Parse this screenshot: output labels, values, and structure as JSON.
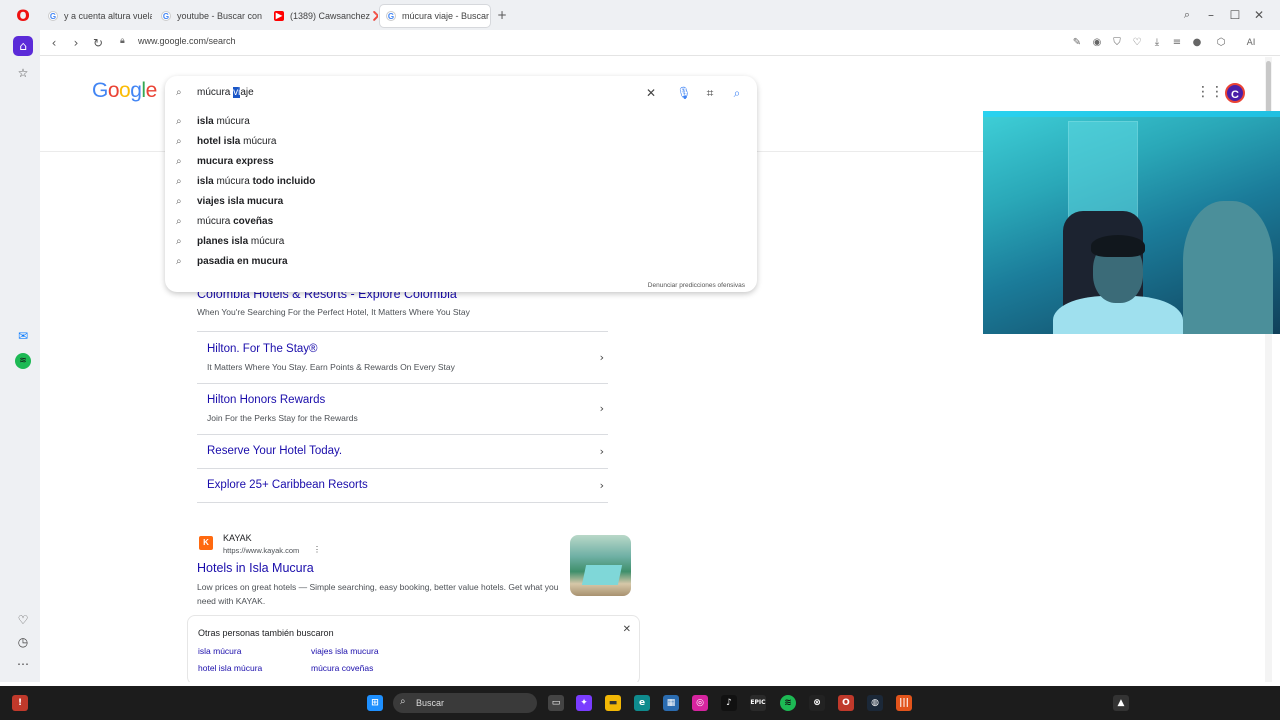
{
  "browser": {
    "tabs": [
      {
        "title": "y a cuenta altura vuela el a"
      },
      {
        "title": "youtube - Buscar con Goo"
      },
      {
        "title": "(1389) Cawsanchez ❌ Ma"
      },
      {
        "title": "múcura viaje - Buscar con"
      }
    ],
    "new_tab": "+",
    "url": "www.google.com/search",
    "ai_label": "AI"
  },
  "google": {
    "logo": [
      "G",
      "o",
      "o",
      "g",
      "l",
      "e"
    ],
    "search": {
      "query_before": "múcura ",
      "query_selected": "vi",
      "query_after": "aje"
    },
    "suggestions": [
      {
        "bold": "isla",
        "rest": " múcura",
        "order": "bold-first"
      },
      {
        "bold": "hotel isla",
        "rest": " múcura",
        "order": "bold-first"
      },
      {
        "bold": "express",
        "rest": "mucura ",
        "order": "rest-first"
      },
      {
        "bold": "todo incluido",
        "rest": "isla múcura ",
        "order": "mixed-todo"
      },
      {
        "bold": "viajes isla mucura",
        "rest": "",
        "order": "bold-first"
      },
      {
        "bold": "coveñas",
        "rest": "múcura ",
        "order": "rest-first"
      },
      {
        "bold": "planes isla",
        "rest": " múcura",
        "order": "bold-first"
      },
      {
        "bold": "pasadia en mucura",
        "rest": "",
        "order": "bold-first"
      }
    ],
    "report_link": "Denunciar predicciones ofensivas",
    "avatar_letter": "C"
  },
  "results": {
    "ad": {
      "title": "Colombia Hotels & Resorts - Explore Colombia",
      "subtitle": "When You're Searching For the Perfect Hotel, It Matters Where You Stay",
      "sitelinks": [
        {
          "title": "Hilton. For The Stay®",
          "desc": "It Matters Where You Stay. Earn Points & Rewards On Every Stay"
        },
        {
          "title": "Hilton Honors Rewards",
          "desc": "Join For the Perks Stay for the Rewards"
        },
        {
          "title": "Reserve Your Hotel Today.",
          "desc": ""
        },
        {
          "title": "Explore 25+ Caribbean Resorts",
          "desc": ""
        }
      ],
      "chevron": "›"
    },
    "kayak": {
      "logo_letter": "K",
      "site": "KAYAK",
      "url": "https://www.kayak.com",
      "title": "Hotels in Isla Mucura",
      "desc": "Low prices on great hotels — Simple searching, easy booking, better value hotels. Get what you need with KAYAK."
    },
    "others": {
      "title": "Otras personas también buscaron",
      "links": [
        "isla múcura",
        "viajes isla mucura",
        "hotel isla múcura",
        "múcura coveñas"
      ]
    }
  },
  "taskbar": {
    "search_label": "Buscar"
  }
}
